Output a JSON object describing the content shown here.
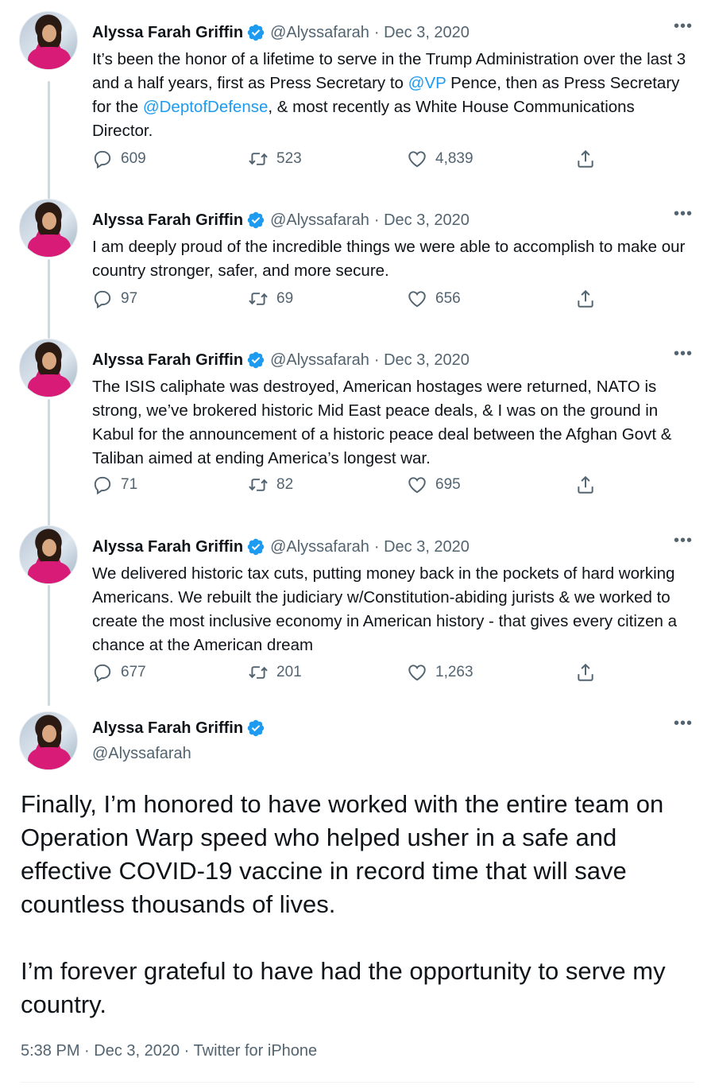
{
  "tweets": [
    {
      "name": "Alyssa Farah Griffin",
      "handle": "@Alyssafarah",
      "date": "· Dec 3, 2020",
      "text_parts": [
        "It’s been the honor of a lifetime to serve in the Trump Administration over the last 3 and a half years, first as Press Secretary to ",
        "@VP",
        " Pence, then as Press Secretary for the ",
        "@DeptofDefense",
        ", & most recently as White House Communications Director."
      ],
      "replies": "609",
      "retweets": "523",
      "likes": "4,839"
    },
    {
      "name": "Alyssa Farah Griffin",
      "handle": "@Alyssafarah",
      "date": "· Dec 3, 2020",
      "text": "I am deeply proud of the incredible things we were able to accomplish to make our country stronger, safer, and more secure.",
      "replies": "97",
      "retweets": "69",
      "likes": "656"
    },
    {
      "name": "Alyssa Farah Griffin",
      "handle": "@Alyssafarah",
      "date": "· Dec 3, 2020",
      "text": "The ISIS caliphate was destroyed, American hostages were returned, NATO is strong, we’ve brokered historic Mid East peace deals, & I was on the ground in Kabul for the announcement of a historic peace deal between the Afghan Govt & Taliban aimed at ending America’s longest war.",
      "replies": "71",
      "retweets": "82",
      "likes": "695"
    },
    {
      "name": "Alyssa Farah Griffin",
      "handle": "@Alyssafarah",
      "date": "· Dec 3, 2020",
      "text": "We delivered historic tax cuts, putting money back in the pockets of hard working Americans. We rebuilt the judiciary w/Constitution-abiding jurists & we worked to create the most inclusive economy in American history - that gives every citizen a chance at the  American dream",
      "replies": "677",
      "retweets": "201",
      "likes": "1,263"
    }
  ],
  "main_tweet": {
    "name": "Alyssa Farah Griffin",
    "handle": "@Alyssafarah",
    "paragraph1": "Finally, I’m honored to have worked with the entire team on Operation Warp speed who helped usher in a safe and effective COVID-19 vaccine in record time that will save countless thousands of lives.",
    "paragraph2": "I’m forever grateful to have had the opportunity to serve my country.",
    "meta": "5:38 PM · Dec 3, 2020 · Twitter for iPhone"
  },
  "more_label": "•••",
  "icons": [
    "verified-badge-icon",
    "reply-icon",
    "retweet-icon",
    "like-icon",
    "share-icon",
    "more-icon"
  ],
  "colors": {
    "link": "#1d9bf0",
    "secondary": "#536471",
    "verified": "#1d9bf0",
    "thread_line": "#cfd9de"
  }
}
